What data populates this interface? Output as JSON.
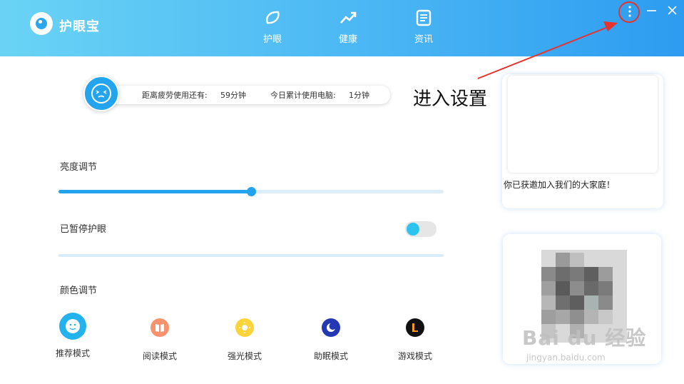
{
  "app": {
    "title": "护眼宝"
  },
  "nav": {
    "tabs": [
      {
        "label": "护眼",
        "icon": "eye-leaf-icon"
      },
      {
        "label": "健康",
        "icon": "trend-icon"
      },
      {
        "label": "资讯",
        "icon": "news-icon"
      }
    ]
  },
  "window": {
    "more_icon": "more-vertical-icon",
    "min_icon": "minimize-icon",
    "close_icon": "close-icon"
  },
  "status": {
    "fatigue_label": "距离疲劳使用还有:",
    "fatigue_value": "59分钟",
    "today_label": "今日累计使用电脑:",
    "today_value": "1分钟"
  },
  "brightness": {
    "title": "亮度调节",
    "level": 0.5
  },
  "pause": {
    "title": "已暂停护眼",
    "toggle_on": true
  },
  "color": {
    "title": "颜色调节",
    "modes": [
      {
        "label": "推荐模式",
        "icon": "recommend-face-icon",
        "color": "#22b3ee"
      },
      {
        "label": "阅读模式",
        "icon": "book-icon",
        "color": "#f7926c"
      },
      {
        "label": "强光模式",
        "icon": "sun-icon",
        "color": "#fbd43a"
      },
      {
        "label": "助眠模式",
        "icon": "moon-icon",
        "color": "#2438b4"
      },
      {
        "label": "游戏模式",
        "icon": "game-l-icon",
        "color": "#111111"
      }
    ]
  },
  "cards": {
    "invite_text": "你已获邀加入我们的大家庭！"
  },
  "annotation": {
    "text": "进入设置",
    "color": "#e8322b"
  },
  "watermark": {
    "main": "Bai du 经验",
    "sub": "jingyan.baidu.com"
  },
  "colors": {
    "accent": "#23a3ee",
    "header_start": "#6ad3f5",
    "header_end": "#2d9cf0"
  }
}
